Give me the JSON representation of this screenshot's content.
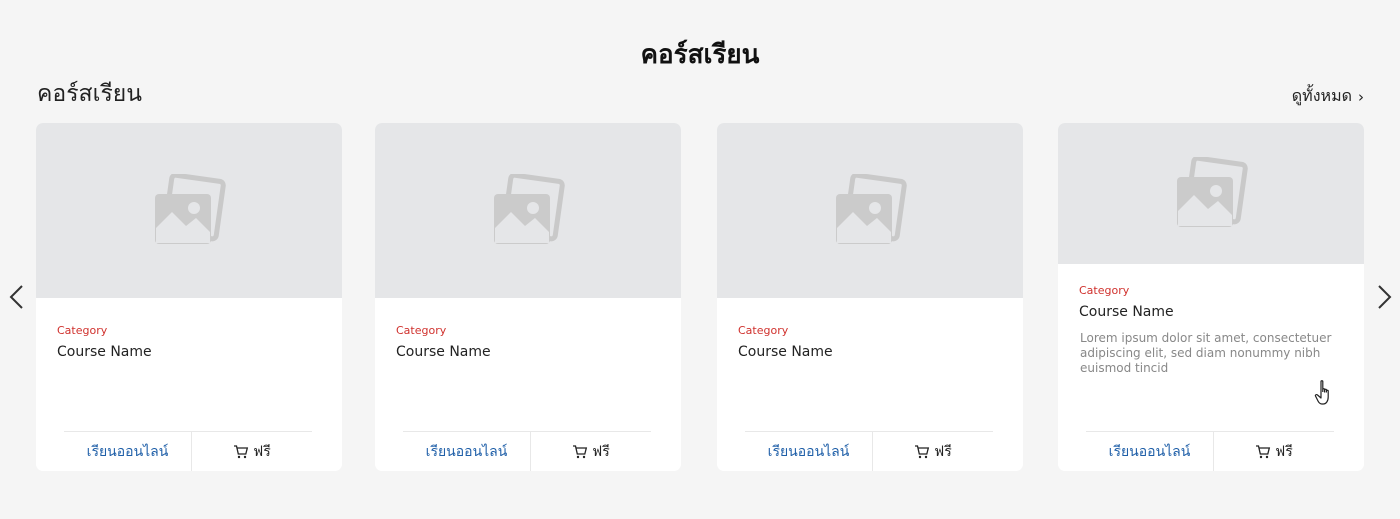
{
  "header": {
    "main_title": "คอร์สเรียน",
    "section_title": "คอร์สเรียน",
    "see_all": "ดูทั้งหมด",
    "see_all_chevron": "›"
  },
  "colors": {
    "category": "#d0312d",
    "learn_link": "#1f5fa8",
    "placeholder_bg": "#e5e6e8"
  },
  "cards": [
    {
      "category": "Category",
      "name": "Course Name",
      "description": "",
      "learn_label": "เรียนออนไลน์",
      "buy_label": "ฟรี",
      "image_icon": "image-placeholder-icon",
      "cart_icon": "cart-icon"
    },
    {
      "category": "Category",
      "name": "Course Name",
      "description": "",
      "learn_label": "เรียนออนไลน์",
      "buy_label": "ฟรี",
      "image_icon": "image-placeholder-icon",
      "cart_icon": "cart-icon"
    },
    {
      "category": "Category",
      "name": "Course Name",
      "description": "",
      "learn_label": "เรียนออนไลน์",
      "buy_label": "ฟรี",
      "image_icon": "image-placeholder-icon",
      "cart_icon": "cart-icon"
    },
    {
      "category": "Category",
      "name": "Course Name",
      "description": "Lorem ipsum dolor sit amet, consectetuer adipiscing elit, sed diam nonummy nibh euismod tincid",
      "learn_label": "เรียนออนไลน์",
      "buy_label": "ฟรี",
      "image_icon": "image-placeholder-icon",
      "cart_icon": "cart-icon"
    }
  ],
  "carousel": {
    "prev_icon": "chevron-left-icon",
    "next_icon": "chevron-right-icon"
  }
}
